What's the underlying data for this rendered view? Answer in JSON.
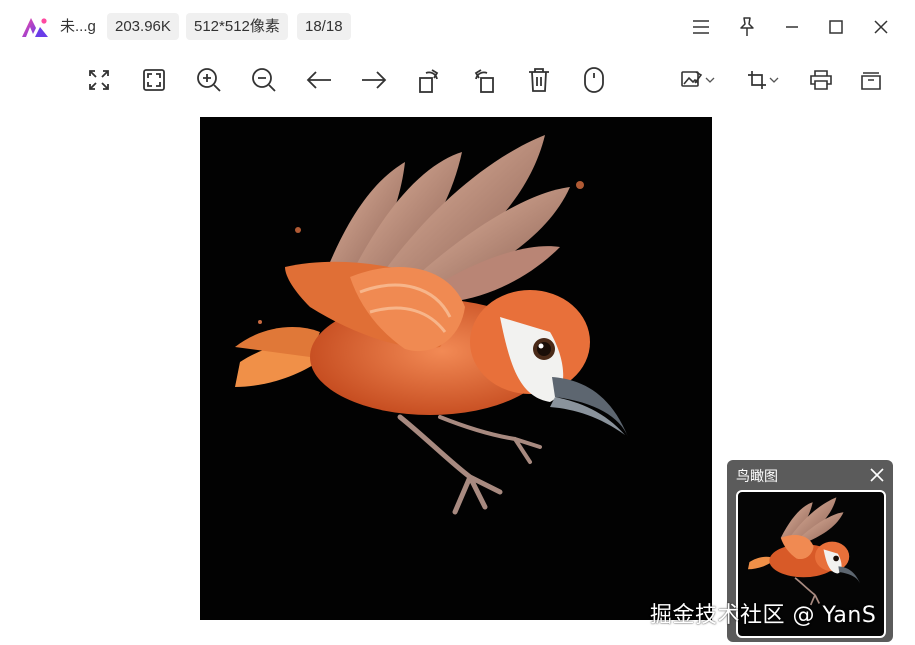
{
  "titlebar": {
    "file_name": "未...g",
    "file_size": "203.96K",
    "dimensions": "512*512像素",
    "counter": "18/18",
    "window_buttons": [
      "menu-icon",
      "pin-icon",
      "minimize-icon",
      "maximize-icon",
      "close-icon"
    ]
  },
  "toolbar": {
    "tools": [
      "fit-window-icon",
      "actual-size-icon",
      "zoom-in-icon",
      "zoom-out-icon",
      "previous-arrow-icon",
      "next-arrow-icon",
      "rotate-left-icon",
      "rotate-right-icon",
      "delete-icon",
      "mouse-icon",
      "image-edit-icon",
      "crop-icon",
      "print-icon",
      "more-icon"
    ]
  },
  "navigator": {
    "title": "鸟瞰图"
  },
  "watermark": "掘金技术社区 @ YanS",
  "colors": {
    "accent_logo": "#6a3de8",
    "canvas_bg": "#020202",
    "navigator_bg": "#5b5b5b",
    "icon": "#333333"
  }
}
